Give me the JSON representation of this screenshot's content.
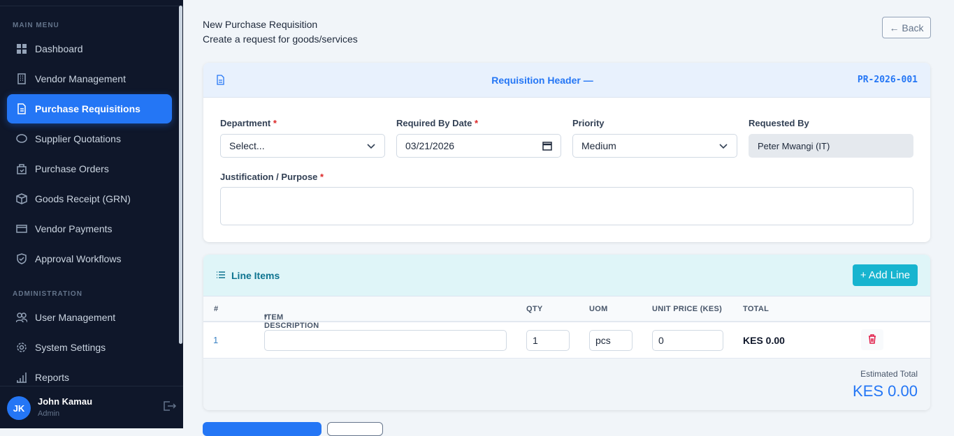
{
  "sidebar": {
    "main_menu": "MAIN MENU",
    "admin": "ADMINISTRATION",
    "items": [
      {
        "label": "Dashboard"
      },
      {
        "label": "Vendor Management"
      },
      {
        "label": "Purchase Requisitions"
      },
      {
        "label": "Supplier Quotations"
      },
      {
        "label": "Purchase Orders"
      },
      {
        "label": "Goods Receipt (GRN)"
      },
      {
        "label": "Vendor Payments"
      },
      {
        "label": "Approval Workflows"
      }
    ],
    "admin_items": [
      {
        "label": "User Management"
      },
      {
        "label": "System Settings"
      },
      {
        "label": "Reports"
      }
    ],
    "user": {
      "initials": "JK",
      "name": "John Kamau",
      "role": "Admin"
    }
  },
  "page": {
    "title": "New Purchase Requisition",
    "subtitle": "Create a request for goods/services",
    "back": "← Back"
  },
  "header_card": {
    "title": "Requisition Header —",
    "number": "PR-2026-001",
    "department_label": "Department",
    "department_value": "Select...",
    "date_label": "Required By Date",
    "date_value": "03/21/2026",
    "priority_label": "Priority",
    "priority_value": "Medium",
    "requested_label": "Requested By",
    "requested_value": "Peter Mwangi (IT)",
    "justification_label": "Justification / Purpose",
    "required_mark": "*"
  },
  "line_items": {
    "title": "Line Items",
    "add": "+ Add Line",
    "columns": [
      "#",
      "ITEM DESCRIPTION",
      "QTY",
      "UOM",
      "UNIT PRICE (KES)",
      "TOTAL"
    ],
    "rows": [
      {
        "no": "1",
        "desc": "",
        "qty": "1",
        "uom": "pcs",
        "price": "0",
        "total": "KES 0.00"
      }
    ],
    "estimated_label": "Estimated Total",
    "estimated_value": "KES 0.00"
  }
}
